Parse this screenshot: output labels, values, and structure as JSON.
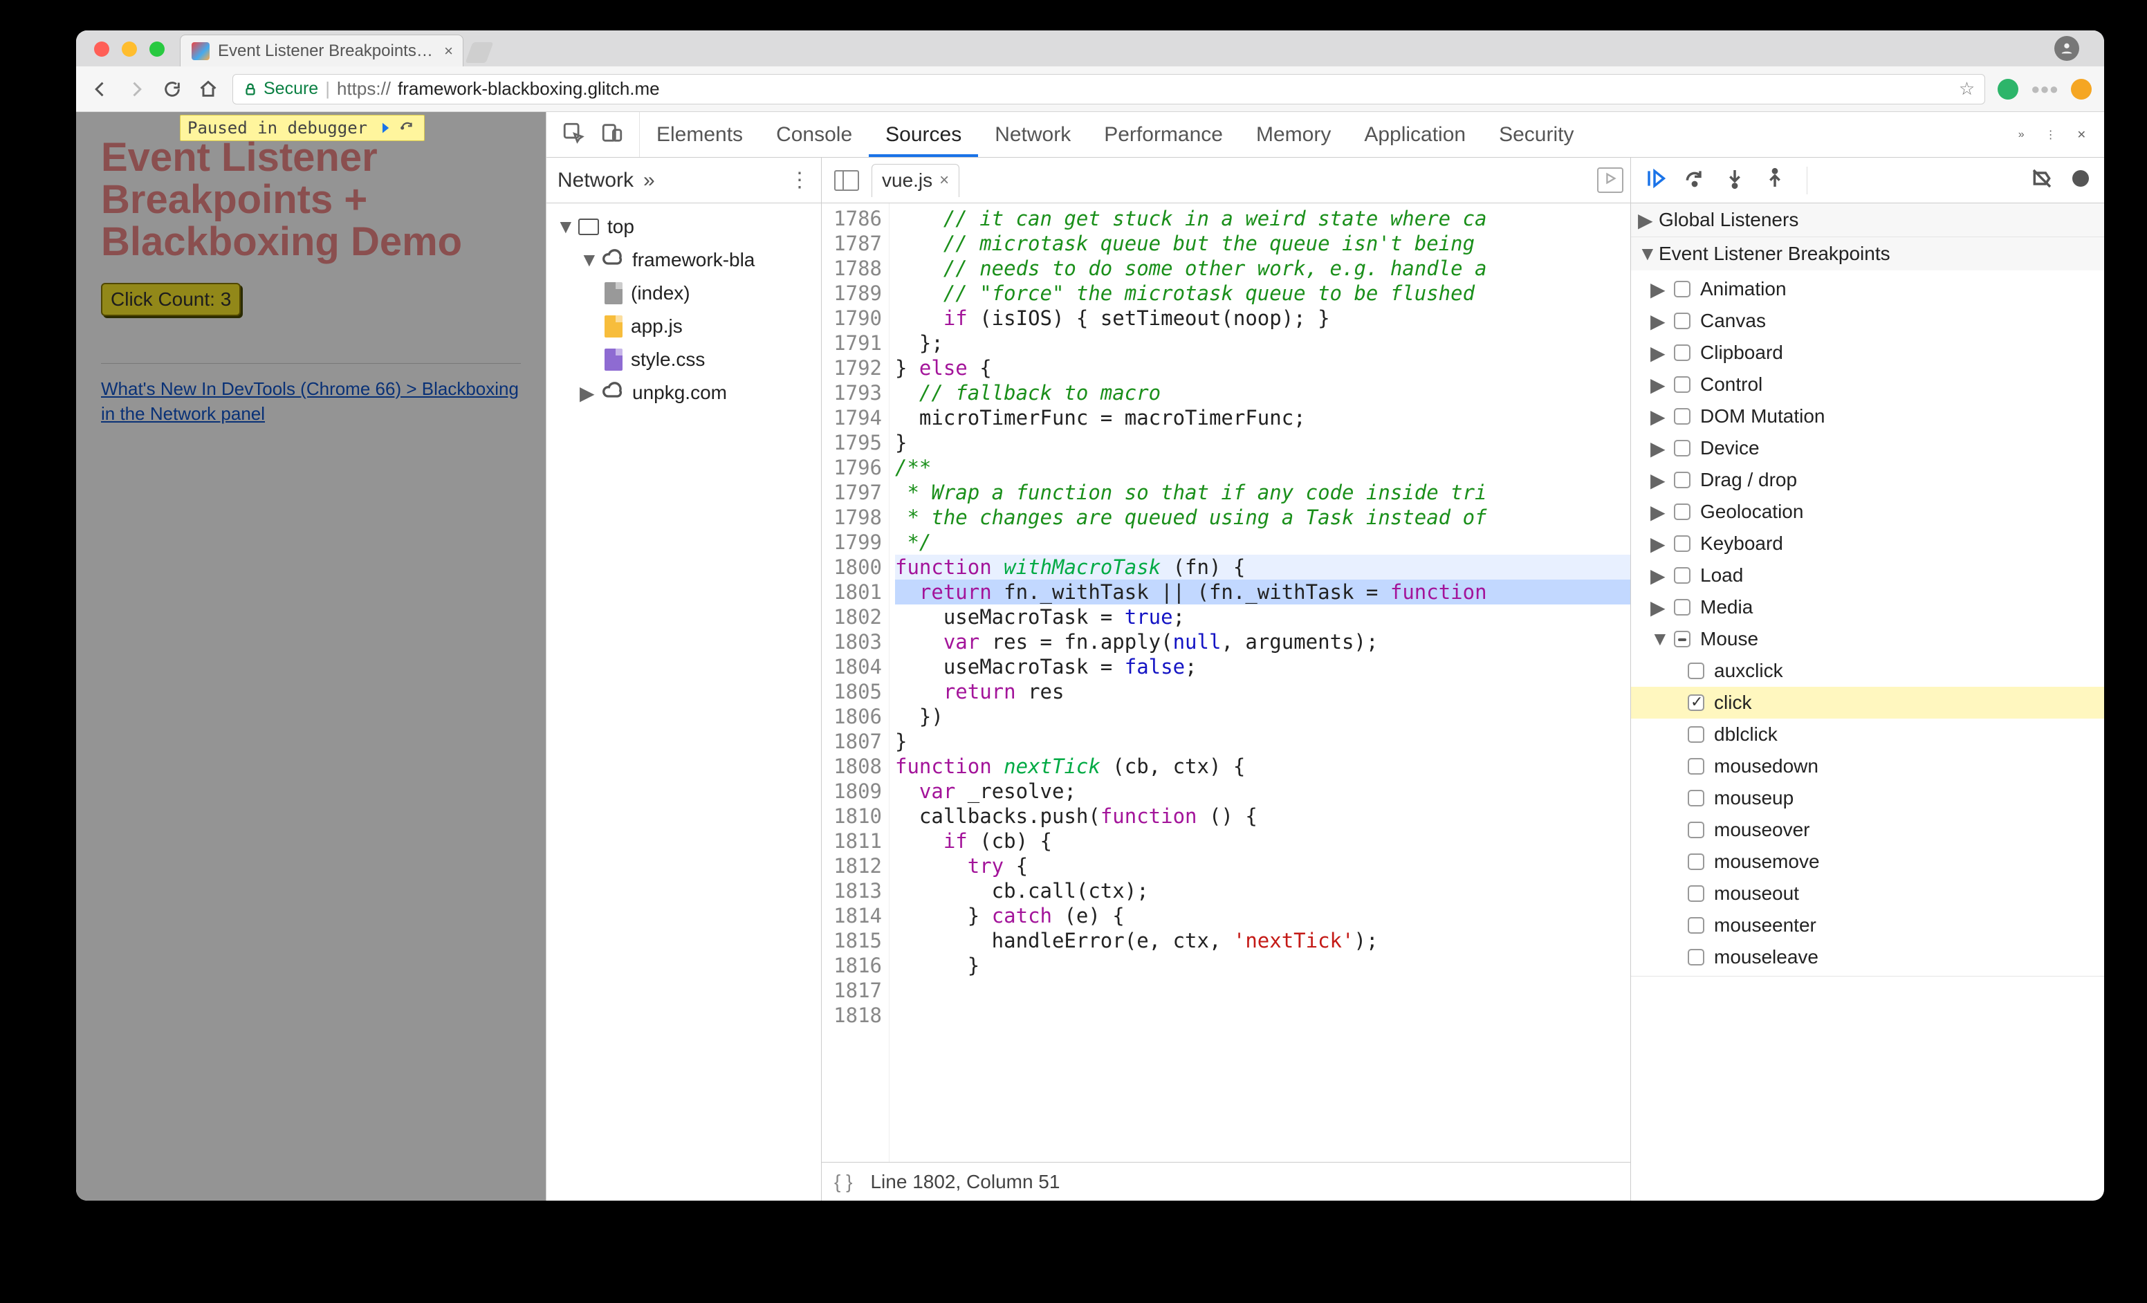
{
  "browser": {
    "tab_title": "Event Listener Breakpoints + B",
    "secure_label": "Secure",
    "url_prefix": "https://",
    "url_host": "framework-blackboxing.glitch.me",
    "paused_label": "Paused in debugger"
  },
  "page": {
    "heading": "Event Listener Breakpoints + Blackboxing Demo",
    "click_label": "Click Count: 3",
    "link_text": "What's New In DevTools (Chrome 66) > Blackboxing in the Network panel"
  },
  "devtools": {
    "tabs": [
      "Elements",
      "Console",
      "Sources",
      "Network",
      "Performance",
      "Memory",
      "Application",
      "Security"
    ],
    "active_tab": "Sources",
    "nav_tab": "Network",
    "tree": {
      "top": "top",
      "domain": "framework-bla",
      "files": [
        "(index)",
        "app.js",
        "style.css"
      ],
      "cdn": "unpkg.com"
    },
    "open_file": "vue.js",
    "gutter_start": 1786,
    "gutter_end": 1818,
    "status": "Line 1802, Column 51",
    "code": [
      {
        "n": 1786,
        "cls": "c-com",
        "t": "    // it can get stuck in a weird state where ca"
      },
      {
        "n": 1787,
        "cls": "c-com",
        "t": "    // microtask queue but the queue isn't being "
      },
      {
        "n": 1788,
        "cls": "c-com",
        "t": "    // needs to do some other work, e.g. handle a"
      },
      {
        "n": 1789,
        "cls": "c-com",
        "t": "    // \"force\" the microtask queue to be flushed"
      },
      {
        "n": 1790,
        "t": "    <kw>if</kw> (isIOS) { setTimeout(noop); }"
      },
      {
        "n": 1791,
        "t": "  };"
      },
      {
        "n": 1792,
        "t": "} <kw>else</kw> {"
      },
      {
        "n": 1793,
        "cls": "c-com",
        "t": "  // fallback to macro"
      },
      {
        "n": 1794,
        "t": "  microTimerFunc = macroTimerFunc;"
      },
      {
        "n": 1795,
        "t": "}"
      },
      {
        "n": 1796,
        "t": ""
      },
      {
        "n": 1797,
        "cls": "c-com",
        "t": "/**"
      },
      {
        "n": 1798,
        "cls": "c-com",
        "t": " * Wrap a function so that if any code inside tri"
      },
      {
        "n": 1799,
        "cls": "c-com",
        "t": " * the changes are queued using a Task instead of"
      },
      {
        "n": 1800,
        "cls": "c-com",
        "t": " */"
      },
      {
        "n": 1801,
        "row": "hl-arrow",
        "t": "<kw>function</kw> <fn>withMacroTask</fn> (fn) {"
      },
      {
        "n": 1802,
        "row": "hl-current",
        "t": "  <kw>return</kw> fn._withTask || (fn._withTask = <kw>function</kw>"
      },
      {
        "n": 1803,
        "t": "    useMacroTask = <lit>true</lit>;"
      },
      {
        "n": 1804,
        "t": "    <kw>var</kw> res = fn.apply(<lit>null</lit>, arguments);"
      },
      {
        "n": 1805,
        "t": "    useMacroTask = <lit>false</lit>;"
      },
      {
        "n": 1806,
        "t": "    <kw>return</kw> res"
      },
      {
        "n": 1807,
        "t": "  })"
      },
      {
        "n": 1808,
        "t": "}"
      },
      {
        "n": 1809,
        "t": ""
      },
      {
        "n": 1810,
        "t": "<kw>function</kw> <fn>nextTick</fn> (cb, ctx) {"
      },
      {
        "n": 1811,
        "t": "  <kw>var</kw> _resolve;"
      },
      {
        "n": 1812,
        "t": "  callbacks.push(<kw>function</kw> () {"
      },
      {
        "n": 1813,
        "t": "    <kw>if</kw> (cb) {"
      },
      {
        "n": 1814,
        "t": "      <kw>try</kw> {"
      },
      {
        "n": 1815,
        "t": "        cb.call(ctx);"
      },
      {
        "n": 1816,
        "t": "      } <kw>catch</kw> (e) {"
      },
      {
        "n": 1817,
        "t": "        handleError(e, ctx, <str>'nextTick'</str>);"
      },
      {
        "n": 1818,
        "t": "      }"
      }
    ],
    "right": {
      "sections": [
        {
          "label": "Global Listeners",
          "open": false
        },
        {
          "label": "Event Listener Breakpoints",
          "open": true
        }
      ],
      "categories": [
        "Animation",
        "Canvas",
        "Clipboard",
        "Control",
        "DOM Mutation",
        "Device",
        "Drag / drop",
        "Geolocation",
        "Keyboard",
        "Load",
        "Media"
      ],
      "mouse_label": "Mouse",
      "mouse_events": [
        {
          "name": "auxclick",
          "checked": false
        },
        {
          "name": "click",
          "checked": true,
          "hl": true
        },
        {
          "name": "dblclick",
          "checked": false
        },
        {
          "name": "mousedown",
          "checked": false
        },
        {
          "name": "mouseup",
          "checked": false
        },
        {
          "name": "mouseover",
          "checked": false
        },
        {
          "name": "mousemove",
          "checked": false
        },
        {
          "name": "mouseout",
          "checked": false
        },
        {
          "name": "mouseenter",
          "checked": false
        },
        {
          "name": "mouseleave",
          "checked": false
        }
      ]
    }
  }
}
